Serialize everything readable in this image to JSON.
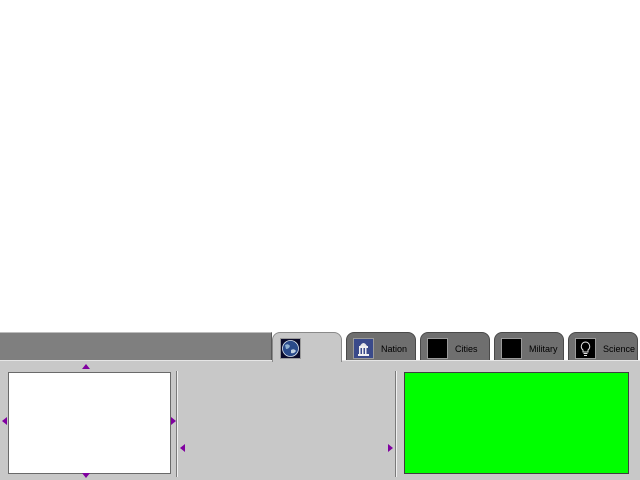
{
  "tabs": [
    {
      "id": "world",
      "label": "",
      "icon": "globe-icon",
      "active": true
    },
    {
      "id": "nation",
      "label": "Nation",
      "icon": "capitol-building-icon",
      "active": false
    },
    {
      "id": "cities",
      "label": "Cities",
      "icon": "city-icon",
      "active": false
    },
    {
      "id": "military",
      "label": "Military",
      "icon": "military-icon",
      "active": false
    },
    {
      "id": "science",
      "label": "Science",
      "icon": "lightbulb-icon",
      "active": false
    }
  ],
  "colors": {
    "panel_background": "#c8c8c8",
    "tab_strip": "#7f7f7f",
    "info_display": "#00ff00",
    "scroll_arrows": "#8000a0",
    "minimap_background": "#ffffff"
  }
}
